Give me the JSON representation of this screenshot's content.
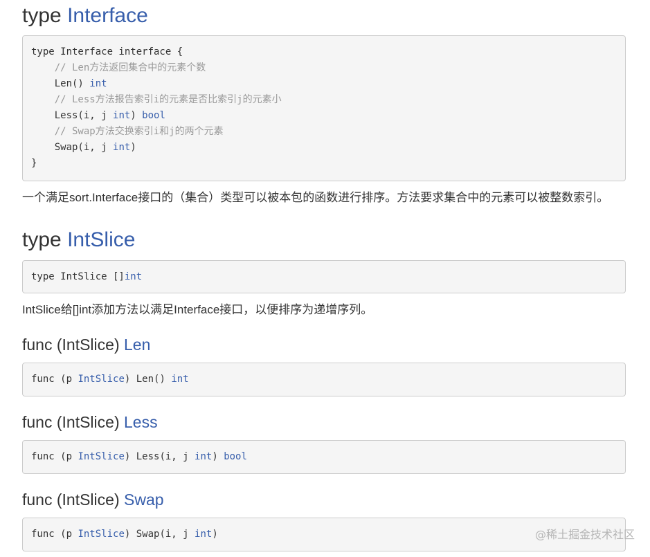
{
  "sections": {
    "interface": {
      "heading": {
        "keyword": "type",
        "name": "Interface"
      },
      "code": {
        "line1": {
          "a": "type Interface interface {"
        },
        "line2": {
          "comment": "    // Len方法返回集合中的元素个数"
        },
        "line3": {
          "a": "    Len() ",
          "t": "int"
        },
        "line4": {
          "comment": "    // Less方法报告索引i的元素是否比索引j的元素小"
        },
        "line5": {
          "a": "    Less(i, j ",
          "t1": "int",
          "b": ") ",
          "t2": "bool"
        },
        "line6": {
          "comment": "    // Swap方法交换索引i和j的两个元素"
        },
        "line7": {
          "a": "    Swap(i, j ",
          "t": "int",
          "b": ")"
        },
        "line8": {
          "a": "}"
        }
      },
      "description": "一个满足sort.Interface接口的（集合）类型可以被本包的函数进行排序。方法要求集合中的元素可以被整数索引。"
    },
    "intslice": {
      "heading": {
        "keyword": "type",
        "name": "IntSlice"
      },
      "code": {
        "a": "type IntSlice []",
        "t": "int"
      },
      "description": "IntSlice给[]int添加方法以满足Interface接口，以便排序为递增序列。"
    },
    "len": {
      "heading": {
        "prefix": "func (IntSlice)",
        "name": "Len"
      },
      "code": {
        "a": "func (p ",
        "t1": "IntSlice",
        "b": ") Len() ",
        "t2": "int"
      }
    },
    "less": {
      "heading": {
        "prefix": "func (IntSlice)",
        "name": "Less"
      },
      "code": {
        "a": "func (p ",
        "t1": "IntSlice",
        "b": ") Less(i, j ",
        "t2": "int",
        "c": ") ",
        "t3": "bool"
      }
    },
    "swap": {
      "heading": {
        "prefix": "func (IntSlice)",
        "name": "Swap"
      },
      "code": {
        "a": "func (p ",
        "t1": "IntSlice",
        "b": ") Swap(i, j ",
        "t2": "int",
        "c": ")"
      }
    }
  },
  "watermark": "@稀土掘金技术社区",
  "colors": {
    "identifier": "#375eab",
    "comment": "#999999",
    "text": "#333333",
    "code_bg": "#f5f5f5",
    "border": "#cccccc"
  }
}
